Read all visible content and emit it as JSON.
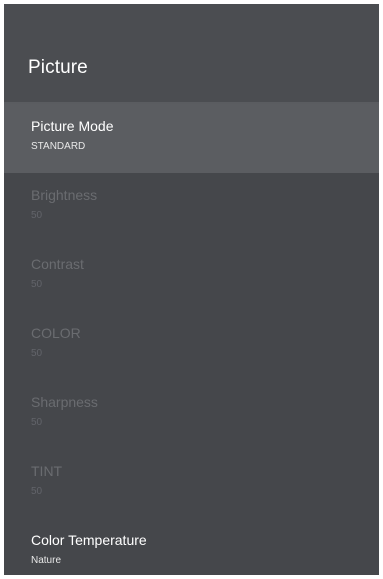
{
  "header": {
    "title": "Picture"
  },
  "items": [
    {
      "title": "Picture Mode",
      "value": "STANDARD",
      "selected": true,
      "enabled": true
    },
    {
      "title": "Brightness",
      "value": "50",
      "selected": false,
      "enabled": false
    },
    {
      "title": "Contrast",
      "value": "50",
      "selected": false,
      "enabled": false
    },
    {
      "title": "COLOR",
      "value": "50",
      "selected": false,
      "enabled": false
    },
    {
      "title": "Sharpness",
      "value": "50",
      "selected": false,
      "enabled": false
    },
    {
      "title": "TINT",
      "value": "50",
      "selected": false,
      "enabled": false
    },
    {
      "title": "Color Temperature",
      "value": "Nature",
      "selected": false,
      "enabled": true
    }
  ]
}
